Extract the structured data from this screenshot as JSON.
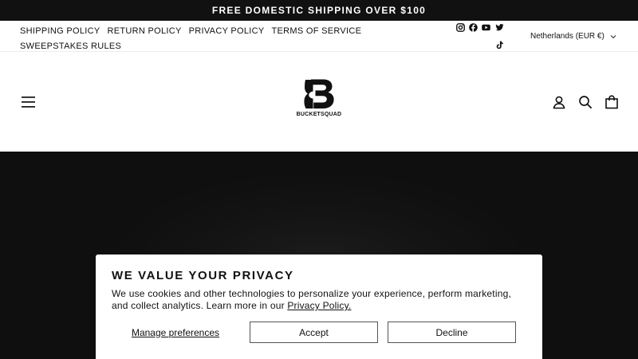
{
  "announcement": {
    "text": "FREE DOMESTIC SHIPPING OVER $100"
  },
  "policy_links": [
    {
      "label": "SHIPPING POLICY"
    },
    {
      "label": "RETURN POLICY"
    },
    {
      "label": "PRIVACY POLICY"
    },
    {
      "label": "TERMS OF SERVICE"
    },
    {
      "label": "SWEEPSTAKES RULES"
    }
  ],
  "social_icons": [
    "instagram-icon",
    "facebook-icon",
    "youtube-icon",
    "twitter-icon",
    "tiktok-icon"
  ],
  "locale": {
    "selected": "Netherlands (EUR €)",
    "icon": "chevron-down-icon"
  },
  "header": {
    "logo_text": "BUCKETSQUAD",
    "icons": [
      "menu-icon",
      "account-icon",
      "search-icon",
      "cart-icon"
    ]
  },
  "cookie_banner": {
    "title": "WE VALUE YOUR PRIVACY",
    "text_before": "We use cookies and other technologies to personalize your experience, perform marketing, and collect analytics. Learn more in our ",
    "link_label": "Privacy Policy.",
    "manage_label": "Manage preferences",
    "accept_label": "Accept",
    "decline_label": "Decline"
  },
  "colors": {
    "announcement_bg": "#111111",
    "hero_bg": "#0f0f0f",
    "text": "#111111"
  }
}
